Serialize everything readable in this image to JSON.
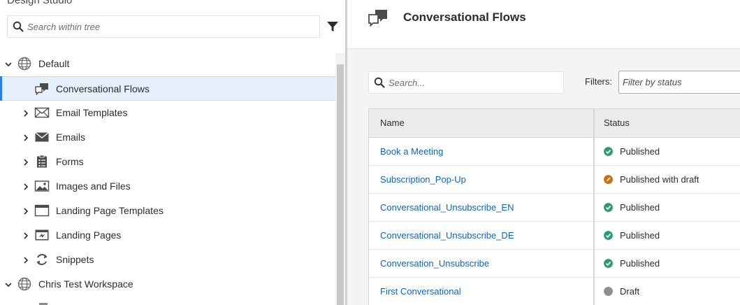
{
  "sidebar": {
    "title": "Design Studio",
    "search_placeholder": "Search within tree",
    "tree": [
      {
        "label": "Default",
        "icon": "globe-icon",
        "expanded": true
      },
      {
        "label": "Conversational Flows",
        "icon": "chat-bubbles-icon",
        "selected": true
      },
      {
        "label": "Email Templates",
        "icon": "envelope-outline-icon"
      },
      {
        "label": "Emails",
        "icon": "envelope-icon"
      },
      {
        "label": "Forms",
        "icon": "clipboard-form-icon"
      },
      {
        "label": "Images and Files",
        "icon": "image-icon"
      },
      {
        "label": "Landing Page Templates",
        "icon": "window-template-icon"
      },
      {
        "label": "Landing Pages",
        "icon": "landing-page-icon"
      },
      {
        "label": "Snippets",
        "icon": "snippets-refresh-icon"
      },
      {
        "label": "Chris Test Workspace",
        "icon": "globe-icon",
        "expanded": true
      }
    ]
  },
  "main": {
    "title": "Conversational Flows",
    "title_icon": "chat-bubbles-icon",
    "search_placeholder": "Search...",
    "filters_label": "Filters:",
    "filter_placeholder": "Filter by status",
    "table": {
      "columns": [
        "Name",
        "Status"
      ],
      "rows": [
        {
          "name": "Book a Meeting",
          "status": "Published",
          "status_type": "published"
        },
        {
          "name": "Subscription_Pop-Up",
          "status": "Published with draft",
          "status_type": "draft-pending"
        },
        {
          "name": "Conversational_Unsubscribe_EN",
          "status": "Published",
          "status_type": "published"
        },
        {
          "name": "Conversational_Unsubscribe_DE",
          "status": "Published",
          "status_type": "published"
        },
        {
          "name": "Conversation_Unsubscribe",
          "status": "Published",
          "status_type": "published"
        },
        {
          "name": "First Conversational",
          "status": "Draft",
          "status_type": "draft"
        }
      ]
    }
  },
  "colors": {
    "published": "#2d9d78",
    "draft-pending": "#cb6f10",
    "draft": "#8e8e8e",
    "link": "#1066b8",
    "selection": "#e6f0fb",
    "accent": "#2680eb"
  }
}
